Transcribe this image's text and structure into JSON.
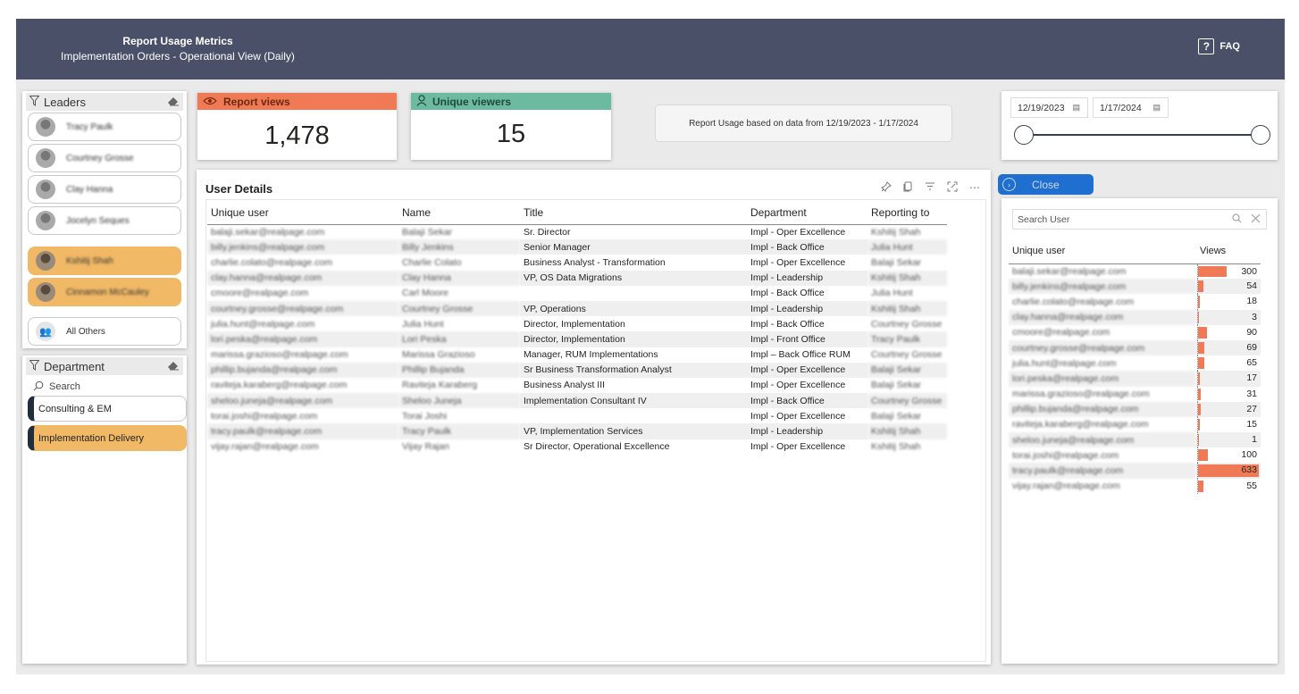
{
  "header": {
    "title": "Report Usage Metrics",
    "subtitle": "Implementation Orders - Operational View (Daily)",
    "faq_label": "FAQ"
  },
  "leaders": {
    "title": "Leaders",
    "items": [
      {
        "name": "Tracy Paulk",
        "selected": false
      },
      {
        "name": "Courtney Grosse",
        "selected": false
      },
      {
        "name": "Clay Hanna",
        "selected": false
      },
      {
        "name": "Jocelyn Seques",
        "selected": false
      },
      {
        "name": "Kshitij Shah",
        "selected": true
      },
      {
        "name": "Cinnamon McCauley",
        "selected": true
      }
    ],
    "all_others": "All Others"
  },
  "department": {
    "title": "Department",
    "search_placeholder": "Search",
    "items": [
      {
        "label": "Consulting & EM",
        "selected": false
      },
      {
        "label": "Implementation Delivery",
        "selected": true
      }
    ]
  },
  "kpis": {
    "report_views_label": "Report views",
    "report_views_value": "1,478",
    "unique_viewers_label": "Unique viewers",
    "unique_viewers_value": "15"
  },
  "info_text": "Report Usage based on data from 12/19/2023 - 1/17/2024",
  "date_range": {
    "start": "12/19/2023",
    "end": "1/17/2024"
  },
  "user_details": {
    "title": "User Details",
    "columns": [
      "Unique user",
      "Name",
      "Title",
      "Department",
      "Reporting to"
    ],
    "rows": [
      [
        "balaji.sekar@realpage.com",
        "Balaji Sekar",
        "Sr. Director",
        "Impl - Oper Excellence",
        "Kshitij Shah"
      ],
      [
        "billy.jenkins@realpage.com",
        "Billy Jenkins",
        "Senior Manager",
        "Impl - Back Office",
        "Julia Hunt"
      ],
      [
        "charlie.colato@realpage.com",
        "Charlie Colato",
        "Business Analyst - Transformation",
        "Impl - Oper Excellence",
        "Balaji Sekar"
      ],
      [
        "clay.hanna@realpage.com",
        "Clay Hanna",
        "VP, OS Data Migrations",
        "Impl - Leadership",
        "Kshitij Shah"
      ],
      [
        "cmoore@realpage.com",
        "Carl Moore",
        "",
        "Impl - Back Office",
        "Julia Hunt"
      ],
      [
        "courtney.grosse@realpage.com",
        "Courtney Grosse",
        "VP, Operations",
        "Impl - Leadership",
        "Kshitij Shah"
      ],
      [
        "julia.hunt@realpage.com",
        "Julia Hunt",
        "Director, Implementation",
        "Impl - Back Office",
        "Courtney Grosse"
      ],
      [
        "lori.peska@realpage.com",
        "Lori Peska",
        "Director, Implementation",
        "Impl - Front Office",
        "Tracy Paulk"
      ],
      [
        "marissa.grazioso@realpage.com",
        "Marissa Grazioso",
        "Manager, RUM Implementations",
        "Impl – Back Office RUM",
        "Courtney Grosse"
      ],
      [
        "phillip.bujanda@realpage.com",
        "Phillip Bujanda",
        "Sr Business Transformation Analyst",
        "Impl - Oper Excellence",
        "Balaji Sekar"
      ],
      [
        "raviteja.karaberg@realpage.com",
        "Raviteja Karaberg",
        "Business Analyst III",
        "Impl - Oper Excellence",
        "Balaji Sekar"
      ],
      [
        "sheloo.juneja@realpage.com",
        "Sheloo Juneja",
        "Implementation Consultant IV",
        "Impl - Back Office",
        "Courtney Grosse"
      ],
      [
        "torai.joshi@realpage.com",
        "Torai Joshi",
        "",
        "Impl - Oper Excellence",
        "Balaji Sekar"
      ],
      [
        "tracy.paulk@realpage.com",
        "Tracy Paulk",
        "VP, Implementation Services",
        "Impl - Leadership",
        "Kshitij Shah"
      ],
      [
        "vijay.rajan@realpage.com",
        "Vijay Rajan",
        "Sr Director, Operational Excellence",
        "Impl - Oper Excellence",
        "Kshitij Shah"
      ]
    ]
  },
  "close_label": "Close",
  "user_views": {
    "search_placeholder": "Search User",
    "col_user": "Unique user",
    "col_views": "Views",
    "rows": [
      {
        "user": "balaji.sekar@realpage.com",
        "views": 300
      },
      {
        "user": "billy.jenkins@realpage.com",
        "views": 54
      },
      {
        "user": "charlie.colato@realpage.com",
        "views": 18
      },
      {
        "user": "clay.hanna@realpage.com",
        "views": 3
      },
      {
        "user": "cmoore@realpage.com",
        "views": 90
      },
      {
        "user": "courtney.grosse@realpage.com",
        "views": 69
      },
      {
        "user": "julia.hunt@realpage.com",
        "views": 65
      },
      {
        "user": "lori.peska@realpage.com",
        "views": 17
      },
      {
        "user": "marissa.grazioso@realpage.com",
        "views": 31
      },
      {
        "user": "phillip.bujanda@realpage.com",
        "views": 27
      },
      {
        "user": "raviteja.karaberg@realpage.com",
        "views": 15
      },
      {
        "user": "sheloo.juneja@realpage.com",
        "views": 1
      },
      {
        "user": "torai.joshi@realpage.com",
        "views": 100
      },
      {
        "user": "tracy.paulk@realpage.com",
        "views": 633
      },
      {
        "user": "vijay.rajan@realpage.com",
        "views": 55
      }
    ]
  },
  "icons": {
    "faq": "question-box-icon",
    "leaders_filter": "funnel-icon",
    "eraser": "eraser-icon",
    "report_views": "eye-icon",
    "unique_viewers": "person-icon",
    "search": "magnifier-icon",
    "close": "chevron-circle-icon",
    "calendar": "calendar-icon"
  },
  "colors": {
    "header_bg": "#4a5068",
    "report_views_accent": "#ef7a55",
    "unique_viewers_accent": "#6cbba0",
    "selected": "#f1b966",
    "close_button": "#1f6fd0",
    "bar": "#ef7a55"
  }
}
